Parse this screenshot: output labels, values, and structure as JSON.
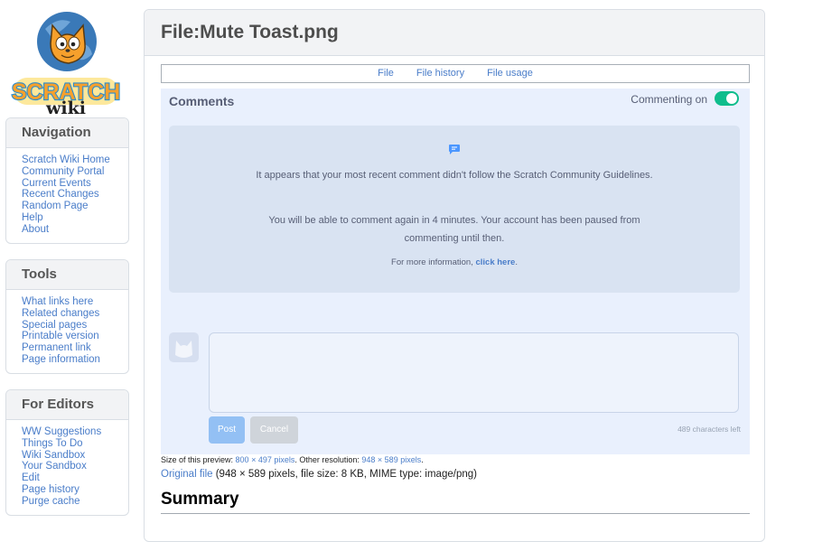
{
  "logo": {
    "text": "SCRATCH wiki"
  },
  "sidebar": {
    "navigation": {
      "title": "Navigation",
      "items": [
        "Scratch Wiki Home",
        "Community Portal",
        "Current Events",
        "Recent Changes",
        "Random Page",
        "Help",
        "About"
      ]
    },
    "tools": {
      "title": "Tools",
      "items": [
        "What links here",
        "Related changes",
        "Special pages",
        "Printable version",
        "Permanent link",
        "Page information"
      ]
    },
    "editors": {
      "title": "For Editors",
      "items": [
        "WW Suggestions",
        "Things To Do",
        "Wiki Sandbox",
        "Your Sandbox",
        "Edit",
        "Page history",
        "Purge cache"
      ]
    }
  },
  "page": {
    "title": "File:Mute Toast.png",
    "tabs": [
      "File",
      "File history",
      "File usage"
    ]
  },
  "preview": {
    "comments_title": "Comments",
    "commenting_label": "Commenting on",
    "commenting_on": true,
    "notice": {
      "p1": "It appears that your most recent comment didn't follow the Scratch Community Guidelines.",
      "p2": "You will be able to comment again in 4 minutes. Your account has been paused from commenting until then.",
      "more_prefix": "For more information, ",
      "more_link": "click here",
      "more_suffix": "."
    },
    "post_label": "Post",
    "cancel_label": "Cancel",
    "chars_left": "489 characters left"
  },
  "file_info": {
    "size_prefix": "Size of this preview: ",
    "size_link": "800 × 497 pixels",
    "other_prefix": ". Other resolution: ",
    "other_link": "948 × 589 pixels",
    "other_suffix": ".",
    "original_link": "Original file",
    "original_details": " (948 × 589 pixels, file size: 8 KB, MIME type: image/png)"
  },
  "summary_heading": "Summary",
  "colors": {
    "link": "#4a7dc9",
    "toggle_on": "#0fbd8c",
    "preview_bg": "#e9f0fd",
    "notice_bg": "#d9e3f2"
  }
}
